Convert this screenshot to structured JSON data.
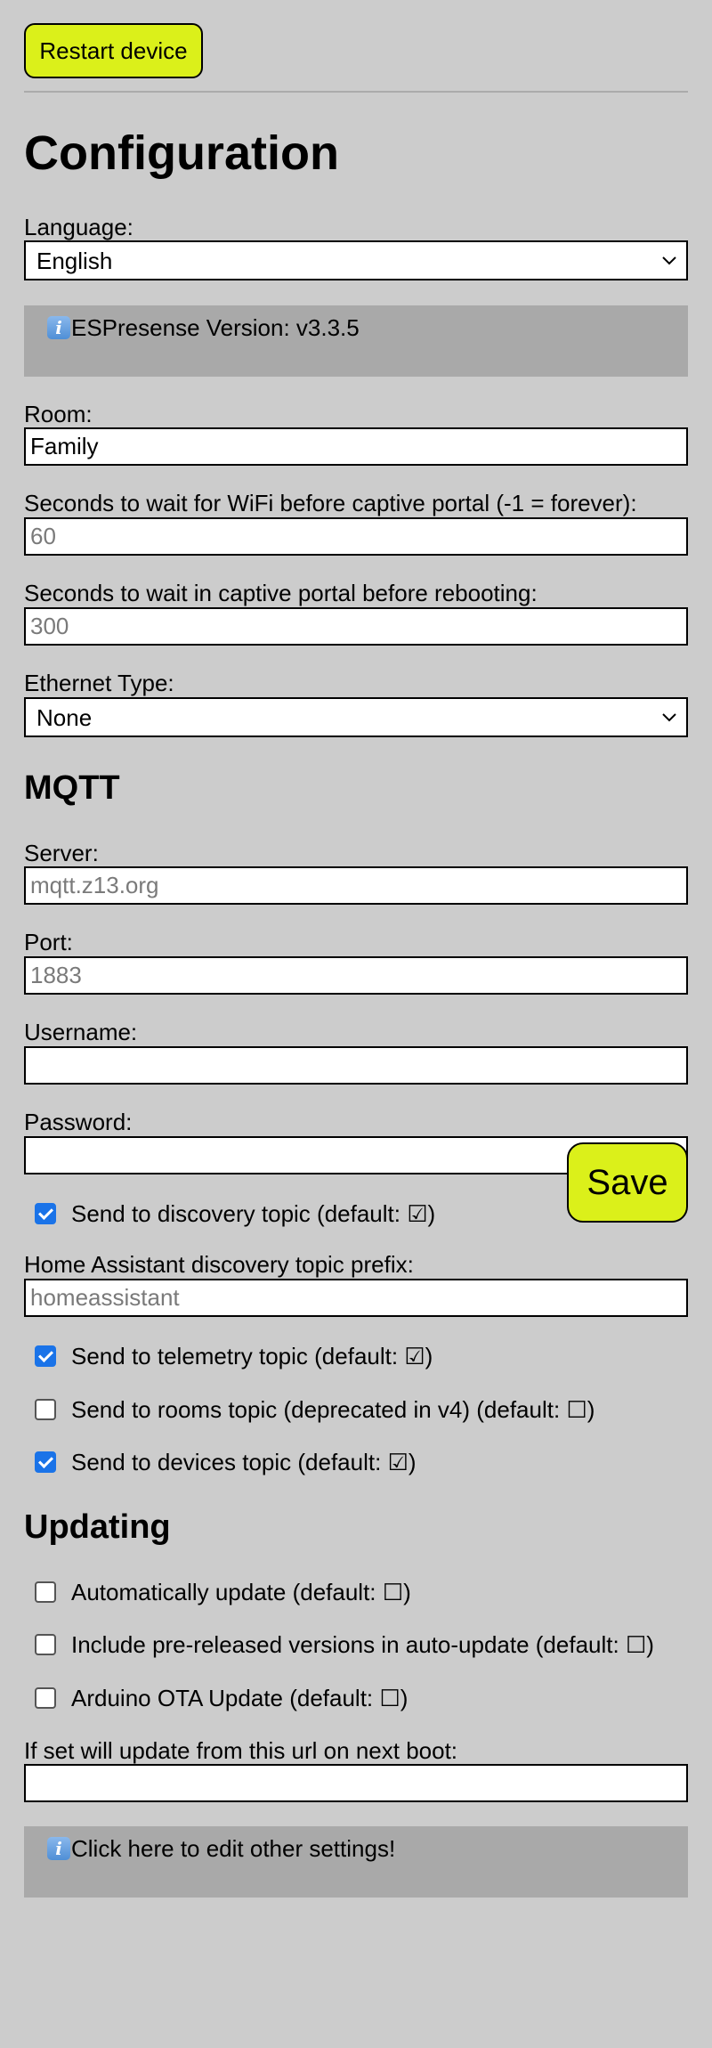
{
  "header": {
    "restart_label": "Restart device"
  },
  "config": {
    "title": "Configuration",
    "language_label": "Language:",
    "language_value": "English",
    "version_text": "ESPresense Version: v3.3.5",
    "room_label": "Room:",
    "room_value": "Family",
    "wifi_wait_label": "Seconds to wait for WiFi before captive portal (-1 = forever):",
    "wifi_wait_placeholder": "60",
    "portal_wait_label": "Seconds to wait in captive portal before rebooting:",
    "portal_wait_placeholder": "300",
    "ethernet_label": "Ethernet Type:",
    "ethernet_value": "None"
  },
  "mqtt": {
    "heading": "MQTT",
    "server_label": "Server:",
    "server_placeholder": "mqtt.z13.org",
    "port_label": "Port:",
    "port_placeholder": "1883",
    "username_label": "Username:",
    "username_value": "",
    "password_label": "Password:",
    "password_value": "",
    "discovery_label": "Send to discovery topic (default: ☑)",
    "discovery_checked": true,
    "ha_prefix_label": "Home Assistant discovery topic prefix:",
    "ha_prefix_placeholder": "homeassistant",
    "telemetry_label": "Send to telemetry topic (default: ☑)",
    "telemetry_checked": true,
    "rooms_label": "Send to rooms topic (deprecated in v4) (default: ☐)",
    "rooms_checked": false,
    "devices_label": "Send to devices topic (default: ☑)",
    "devices_checked": true
  },
  "updating": {
    "heading": "Updating",
    "auto_update_label": "Automatically update (default: ☐)",
    "auto_update_checked": false,
    "prerelease_label": "Include pre-released versions in auto-update (default: ☐)",
    "prerelease_checked": false,
    "ota_label": "Arduino OTA Update (default: ☐)",
    "ota_checked": false,
    "url_label": "If set will update from this url on next boot:",
    "url_value": ""
  },
  "footer": {
    "other_settings_text": "Click here to edit other settings!"
  },
  "actions": {
    "save_label": "Save"
  },
  "icons": {
    "info": "info-icon",
    "dropdown": "chevron-down-icon"
  },
  "colors": {
    "background": "#cccccc",
    "button": "#dbf01a",
    "info_box": "#a9a9a9",
    "checkbox_on": "#1a73e8"
  }
}
